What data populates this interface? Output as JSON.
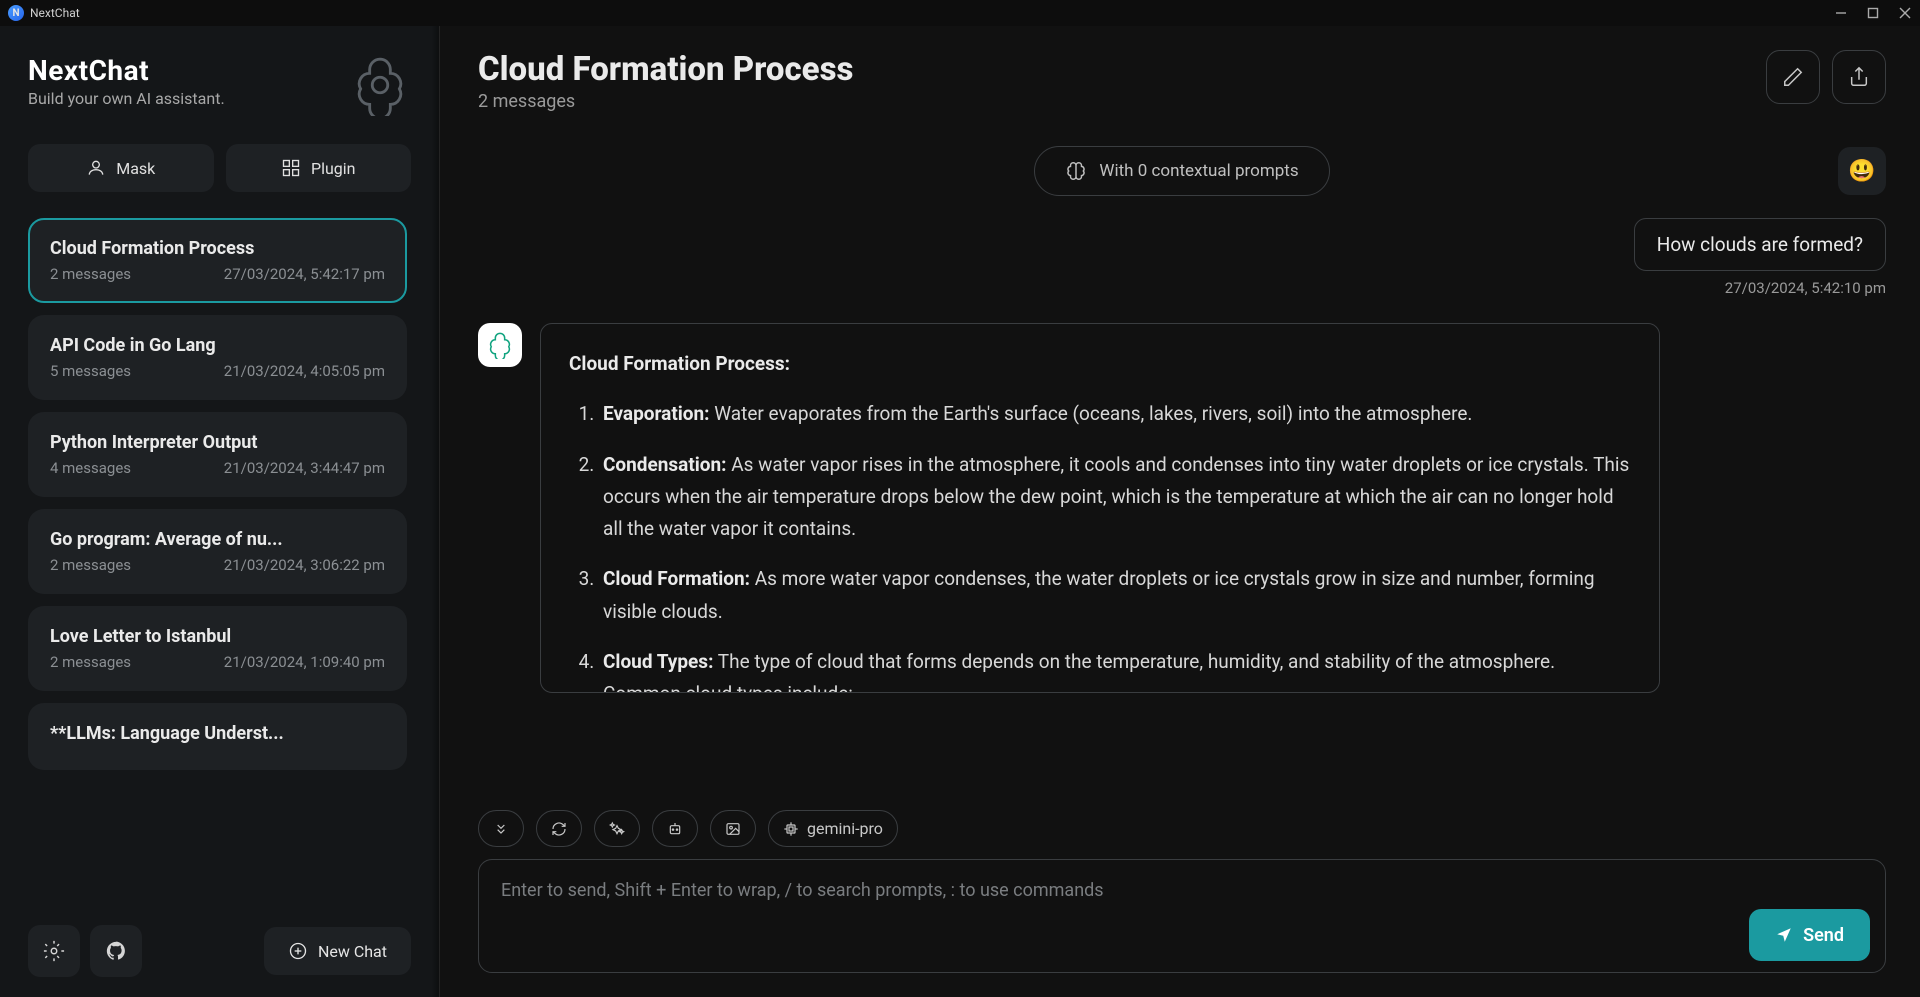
{
  "titlebar": {
    "app_name": "NextChat"
  },
  "sidebar": {
    "brand": "NextChat",
    "tagline": "Build your own AI assistant.",
    "mask_btn": "Mask",
    "plugin_btn": "Plugin",
    "newchat_btn": "New Chat",
    "chats": [
      {
        "title": "Cloud Formation Process",
        "msgs": "2 messages",
        "time": "27/03/2024, 5:42:17 pm",
        "active": true
      },
      {
        "title": "API Code in Go Lang",
        "msgs": "5 messages",
        "time": "21/03/2024, 4:05:05 pm"
      },
      {
        "title": "Python Interpreter Output",
        "msgs": "4 messages",
        "time": "21/03/2024, 3:44:47 pm"
      },
      {
        "title": "Go program: Average of nu...",
        "msgs": "2 messages",
        "time": "21/03/2024, 3:06:22 pm"
      },
      {
        "title": "Love Letter to Istanbul",
        "msgs": "2 messages",
        "time": "21/03/2024, 1:09:40 pm"
      },
      {
        "title": "**LLMs: Language Underst...",
        "msgs": "",
        "time": ""
      }
    ]
  },
  "header": {
    "title": "Cloud Formation Process",
    "sub": "2 messages"
  },
  "context_pill": "With 0 contextual prompts",
  "user_msg": {
    "text": "How clouds are formed?",
    "time": "27/03/2024, 5:42:10 pm"
  },
  "ai_msg": {
    "heading": "Cloud Formation Process:",
    "items": [
      {
        "label": "Evaporation:",
        "body": " Water evaporates from the Earth's surface (oceans, lakes, rivers, soil) into the atmosphere."
      },
      {
        "label": "Condensation:",
        "body": " As water vapor rises in the atmosphere, it cools and condenses into tiny water droplets or ice crystals. This occurs when the air temperature drops below the dew point, which is the temperature at which the air can no longer hold all the water vapor it contains."
      },
      {
        "label": "Cloud Formation:",
        "body": " As more water vapor condenses, the water droplets or ice crystals grow in size and number, forming visible clouds."
      },
      {
        "label": "Cloud Types:",
        "body": " The type of cloud that forms depends on the temperature, humidity, and stability of the atmosphere. Common cloud types include:"
      }
    ]
  },
  "toolbar": {
    "model": "gemini-pro"
  },
  "input": {
    "placeholder": "Enter to send, Shift + Enter to wrap, / to search prompts, : to use commands",
    "send": "Send"
  }
}
